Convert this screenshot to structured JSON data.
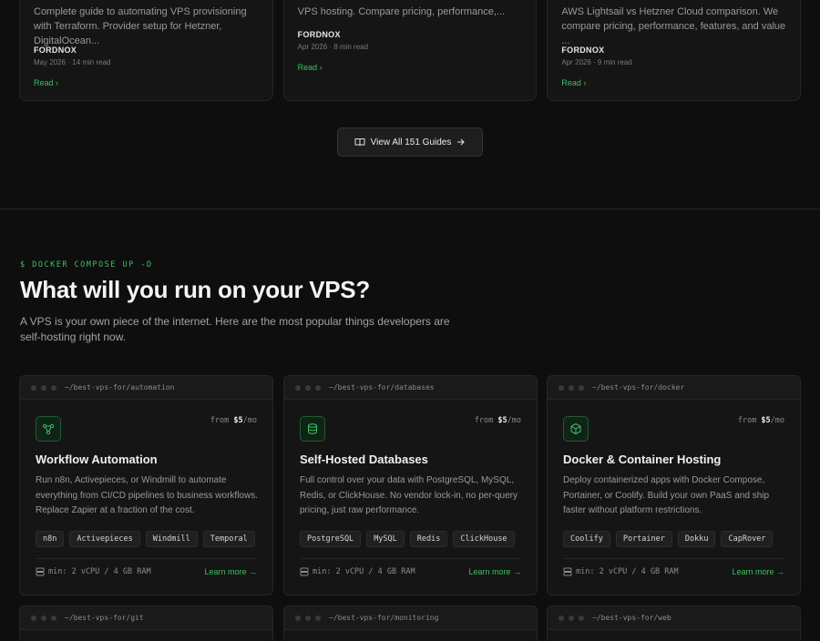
{
  "guides": [
    {
      "excerpt": "Complete guide to automating VPS provisioning with Terraform. Provider setup for Hetzner, DigitalOcean...",
      "author": "FORDNOX",
      "meta": "May 2026 · 14 min read",
      "read": "Read"
    },
    {
      "excerpt": "VPS hosting. Compare pricing, performance,...",
      "author": "FORDNOX",
      "meta": "Apr 2026 · 8 min read",
      "read": "Read"
    },
    {
      "excerpt": "AWS Lightsail vs Hetzner Cloud comparison. We compare pricing, performance, features, and value ...",
      "author": "FORDNOX",
      "meta": "Apr 2026 · 9 min read",
      "read": "Read"
    }
  ],
  "view_all_label": "View All 151 Guides",
  "section": {
    "eyebrow": "$ DOCKER COMPOSE UP -D",
    "title": "What will you run on your VPS?",
    "description": "A VPS is your own piece of the internet. Here are the most popular things developers are self-hosting right now."
  },
  "cards": [
    {
      "path": "~/best-vps-for/automation",
      "from_prefix": "from",
      "price": "$5",
      "per": "/mo",
      "title": "Workflow Automation",
      "desc": "Run n8n, Activepieces, or Windmill to automate everything from CI/CD pipelines to business workflows. Replace Zapier at a fraction of the cost.",
      "tags": [
        "n8n",
        "Activepieces",
        "Windmill",
        "Temporal"
      ],
      "min": "min: 2 vCPU / 4 GB RAM",
      "learn": "Learn more →",
      "icon": "workflow-icon"
    },
    {
      "path": "~/best-vps-for/databases",
      "from_prefix": "from",
      "price": "$5",
      "per": "/mo",
      "title": "Self-Hosted Databases",
      "desc": "Full control over your data with PostgreSQL, MySQL, Redis, or ClickHouse. No vendor lock-in, no per-query pricing, just raw performance.",
      "tags": [
        "PostgreSQL",
        "MySQL",
        "Redis",
        "ClickHouse"
      ],
      "min": "min: 2 vCPU / 4 GB RAM",
      "learn": "Learn more →",
      "icon": "database-icon"
    },
    {
      "path": "~/best-vps-for/docker",
      "from_prefix": "from",
      "price": "$5",
      "per": "/mo",
      "title": "Docker & Container Hosting",
      "desc": "Deploy containerized apps with Docker Compose, Portainer, or Coolify. Build your own PaaS and ship faster without platform restrictions.",
      "tags": [
        "Coolify",
        "Portainer",
        "Dokku",
        "CapRover"
      ],
      "min": "min: 2 vCPU / 4 GB RAM",
      "learn": "Learn more →",
      "icon": "container-icon"
    }
  ],
  "next_cards": [
    {
      "path": "~/best-vps-for/git"
    },
    {
      "path": "~/best-vps-for/monitoring"
    },
    {
      "path": "~/best-vps-for/web"
    }
  ],
  "colors": {
    "accent": "#3fbf62",
    "background": "#0e0e0e",
    "card": "#151515"
  }
}
